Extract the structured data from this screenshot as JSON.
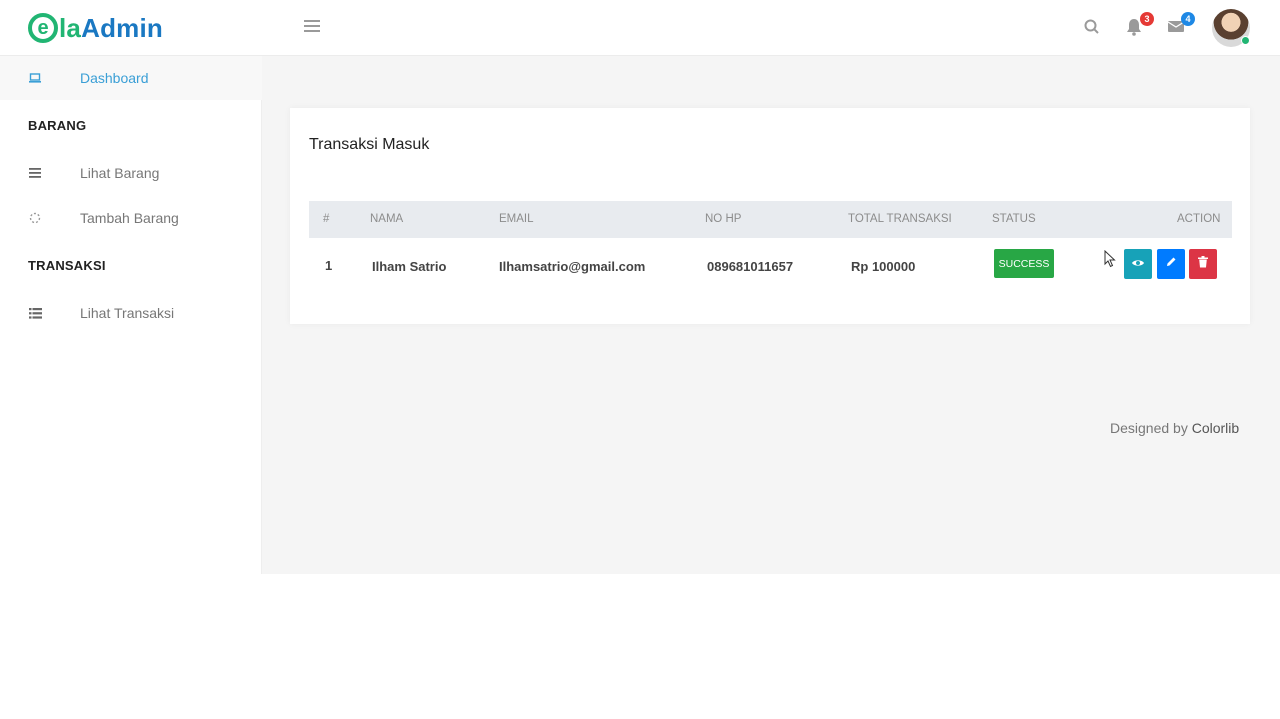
{
  "header": {
    "logo": {
      "e": "e",
      "la": "la",
      "admin": "Admin"
    },
    "notifications_count": "3",
    "messages_count": "4",
    "notif_badge_color": "#e53935",
    "msg_badge_color": "#1e88e5"
  },
  "sidebar": {
    "dashboard": "Dashboard",
    "section_barang": "BARANG",
    "lihat_barang": "Lihat Barang",
    "tambah_barang": "Tambah Barang",
    "section_transaksi": "TRANSAKSI",
    "lihat_transaksi": "Lihat Transaksi"
  },
  "card": {
    "title": "Transaksi Masuk",
    "columns": [
      "#",
      "NAMA",
      "EMAIL",
      "NO HP",
      "TOTAL TRANSAKSI",
      "STATUS",
      "ACTION"
    ],
    "rows": [
      {
        "no": "1",
        "nama": "Ilham Satrio",
        "email": "Ilhamsatrio@gmail.com",
        "no_hp": "089681011657",
        "total": "Rp 100000",
        "status": "SUCCESS"
      }
    ]
  },
  "footer": {
    "prefix": "Designed by",
    "brand": "Colorlib"
  },
  "colors": {
    "accent": "#3a9fd6",
    "success": "#28a745",
    "info": "#17a2b8",
    "primary": "#007bff",
    "danger": "#dc3545"
  }
}
